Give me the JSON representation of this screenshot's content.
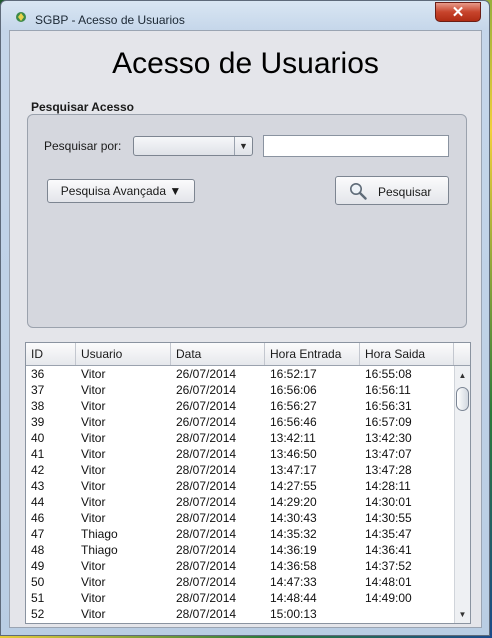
{
  "window": {
    "title": "SGBP - Acesso de Usuarios",
    "close_symbol": "✕"
  },
  "heading": "Acesso de Usuarios",
  "search_group": {
    "title": "Pesquisar Acesso",
    "search_by_label": "Pesquisar por:",
    "search_by_value": "",
    "search_text_value": "",
    "advanced_button": "Pesquisa Avançada ▼",
    "search_button": "Pesquisar"
  },
  "table": {
    "columns": [
      "ID",
      "Usuario",
      "Data",
      "Hora Entrada",
      "Hora Saida"
    ],
    "rows": [
      [
        "36",
        "Vitor",
        "26/07/2014",
        "16:52:17",
        "16:55:08"
      ],
      [
        "37",
        "Vitor",
        "26/07/2014",
        "16:56:06",
        "16:56:11"
      ],
      [
        "38",
        "Vitor",
        "26/07/2014",
        "16:56:27",
        "16:56:31"
      ],
      [
        "39",
        "Vitor",
        "26/07/2014",
        "16:56:46",
        "16:57:09"
      ],
      [
        "40",
        "Vitor",
        "28/07/2014",
        "13:42:11",
        "13:42:30"
      ],
      [
        "41",
        "Vitor",
        "28/07/2014",
        "13:46:50",
        "13:47:07"
      ],
      [
        "42",
        "Vitor",
        "28/07/2014",
        "13:47:17",
        "13:47:28"
      ],
      [
        "43",
        "Vitor",
        "28/07/2014",
        "14:27:55",
        "14:28:11"
      ],
      [
        "44",
        "Vitor",
        "28/07/2014",
        "14:29:20",
        "14:30:01"
      ],
      [
        "46",
        "Vitor",
        "28/07/2014",
        "14:30:43",
        "14:30:55"
      ],
      [
        "47",
        "Thiago",
        "28/07/2014",
        "14:35:32",
        "14:35:47"
      ],
      [
        "48",
        "Thiago",
        "28/07/2014",
        "14:36:19",
        "14:36:41"
      ],
      [
        "49",
        "Vitor",
        "28/07/2014",
        "14:36:58",
        "14:37:52"
      ],
      [
        "50",
        "Vitor",
        "28/07/2014",
        "14:47:33",
        "14:48:01"
      ],
      [
        "51",
        "Vitor",
        "28/07/2014",
        "14:48:44",
        "14:49:00"
      ],
      [
        "52",
        "Vitor",
        "28/07/2014",
        "15:00:13",
        ""
      ]
    ]
  },
  "icons": {
    "app": "app-icon",
    "search": "magnifier-icon",
    "combo_arrow": "chevron-down-icon"
  }
}
